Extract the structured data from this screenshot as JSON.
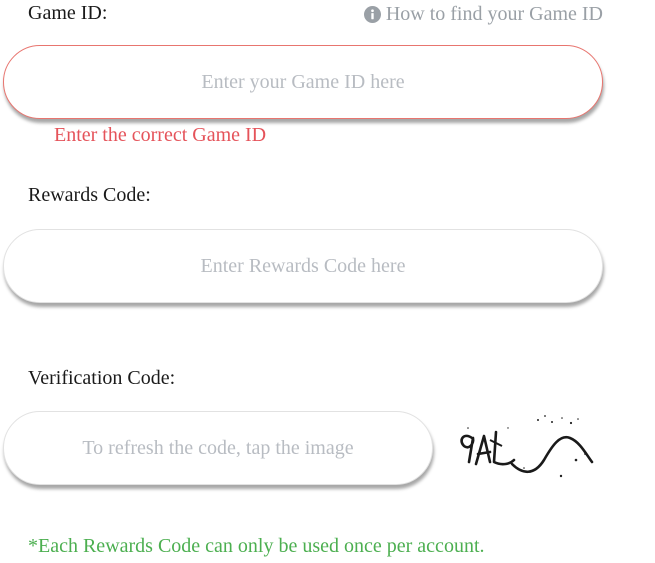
{
  "game_id": {
    "label": "Game ID:",
    "help_link": "How to find your Game ID",
    "help_icon": "info-circle-icon",
    "placeholder": "Enter your Game ID here",
    "value": "",
    "error": "Enter the correct Game ID"
  },
  "rewards_code": {
    "label": "Rewards Code:",
    "placeholder": "Enter Rewards Code here",
    "value": ""
  },
  "verification_code": {
    "label": "Verification Code:",
    "placeholder": "To refresh the code, tap the image",
    "value": "",
    "captcha_text": "9AL"
  },
  "footer_note": "*Each Rewards Code can only be used once per account.",
  "colors": {
    "error": "#e5535a",
    "note": "#4caf50",
    "placeholder": "#b8bcc2",
    "help_link": "#9aa0a6"
  }
}
